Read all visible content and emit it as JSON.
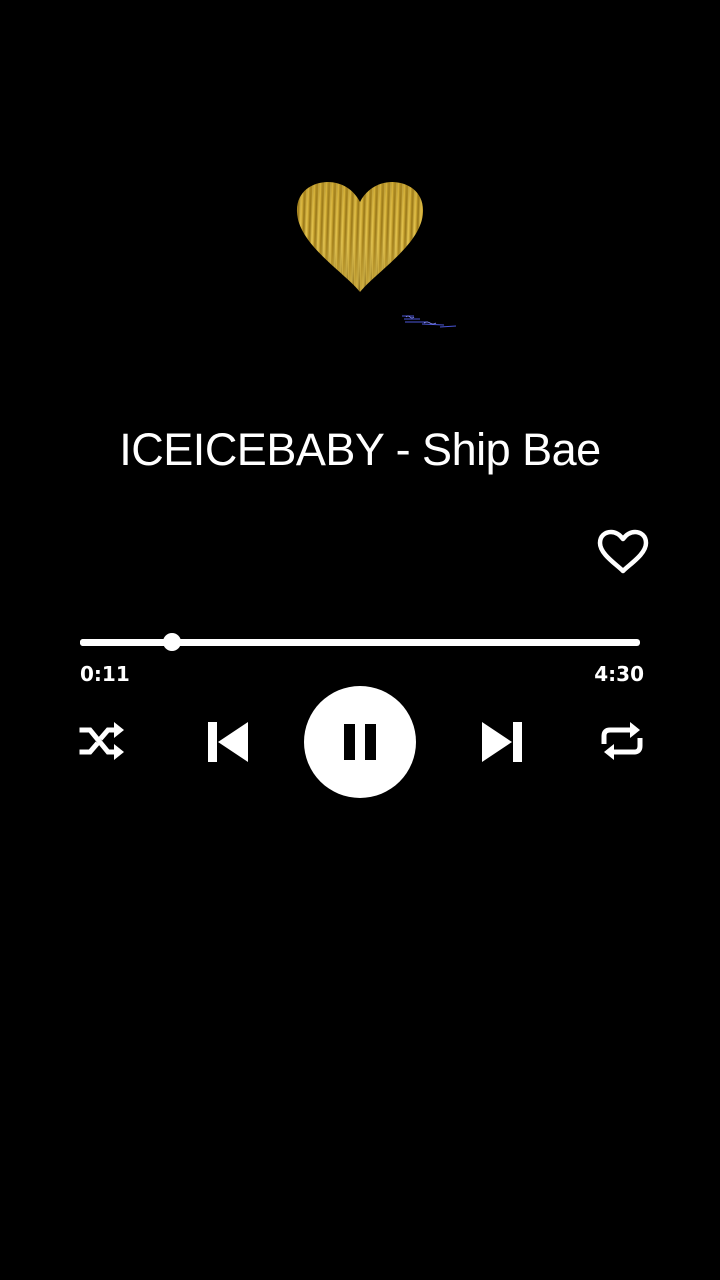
{
  "track": {
    "title": "ICEICEBABY - Ship Bae",
    "elapsed": "0:11",
    "duration": "4:30",
    "progress_fraction": 0.165
  },
  "colors": {
    "background": "#000000",
    "foreground": "#ffffff",
    "heart_gold": "#c9a227"
  },
  "icons": {
    "decor": "gold-heart-icon",
    "like": "heart-outline-icon",
    "shuffle": "shuffle-icon",
    "previous": "skip-previous-icon",
    "play_pause": "pause-icon",
    "next": "skip-next-icon",
    "repeat": "repeat-icon"
  }
}
